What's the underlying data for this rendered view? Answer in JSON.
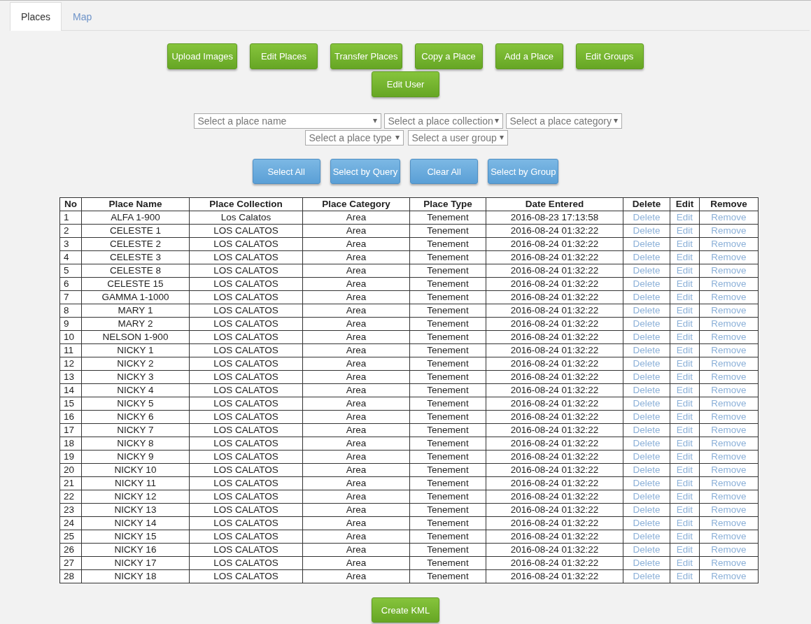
{
  "tabs": [
    {
      "label": "Places",
      "selected": true
    },
    {
      "label": "Map",
      "selected": false
    }
  ],
  "action_buttons": [
    "Upload Images",
    "Edit Places",
    "Transfer Places",
    "Copy a Place",
    "Add a Place",
    "Edit Groups",
    "Edit User"
  ],
  "filters": [
    {
      "placeholder": "Select a place name"
    },
    {
      "placeholder": "Select a place collection"
    },
    {
      "placeholder": "Select a place category"
    },
    {
      "placeholder": "Select a place type"
    },
    {
      "placeholder": "Select a user group"
    }
  ],
  "selection_buttons": [
    "Select All",
    "Select by Query",
    "Clear All",
    "Select by Group"
  ],
  "table": {
    "columns": [
      "No",
      "Place Name",
      "Place Collection",
      "Place Category",
      "Place Type",
      "Date Entered",
      "Delete",
      "Edit",
      "Remove"
    ],
    "rows": [
      {
        "no": "1",
        "name": "ALFA 1-900",
        "collection": "Los Calatos",
        "category": "Area",
        "type": "Tenement",
        "date": "2016-08-23 17:13:58",
        "delete": "Delete",
        "edit": "Edit",
        "remove": "Remove"
      },
      {
        "no": "2",
        "name": "CELESTE 1",
        "collection": "LOS CALATOS",
        "category": "Area",
        "type": "Tenement",
        "date": "2016-08-24 01:32:22",
        "delete": "Delete",
        "edit": "Edit",
        "remove": "Remove"
      },
      {
        "no": "3",
        "name": "CELESTE 2",
        "collection": "LOS CALATOS",
        "category": "Area",
        "type": "Tenement",
        "date": "2016-08-24 01:32:22",
        "delete": "Delete",
        "edit": "Edit",
        "remove": "Remove"
      },
      {
        "no": "4",
        "name": "CELESTE 3",
        "collection": "LOS CALATOS",
        "category": "Area",
        "type": "Tenement",
        "date": "2016-08-24 01:32:22",
        "delete": "Delete",
        "edit": "Edit",
        "remove": "Remove"
      },
      {
        "no": "5",
        "name": "CELESTE 8",
        "collection": "LOS CALATOS",
        "category": "Area",
        "type": "Tenement",
        "date": "2016-08-24 01:32:22",
        "delete": "Delete",
        "edit": "Edit",
        "remove": "Remove"
      },
      {
        "no": "6",
        "name": "CELESTE 15",
        "collection": "LOS CALATOS",
        "category": "Area",
        "type": "Tenement",
        "date": "2016-08-24 01:32:22",
        "delete": "Delete",
        "edit": "Edit",
        "remove": "Remove"
      },
      {
        "no": "7",
        "name": "GAMMA 1-1000",
        "collection": "LOS CALATOS",
        "category": "Area",
        "type": "Tenement",
        "date": "2016-08-24 01:32:22",
        "delete": "Delete",
        "edit": "Edit",
        "remove": "Remove"
      },
      {
        "no": "8",
        "name": "MARY 1",
        "collection": "LOS CALATOS",
        "category": "Area",
        "type": "Tenement",
        "date": "2016-08-24 01:32:22",
        "delete": "Delete",
        "edit": "Edit",
        "remove": "Remove"
      },
      {
        "no": "9",
        "name": "MARY 2",
        "collection": "LOS CALATOS",
        "category": "Area",
        "type": "Tenement",
        "date": "2016-08-24 01:32:22",
        "delete": "Delete",
        "edit": "Edit",
        "remove": "Remove"
      },
      {
        "no": "10",
        "name": "NELSON 1-900",
        "collection": "LOS CALATOS",
        "category": "Area",
        "type": "Tenement",
        "date": "2016-08-24 01:32:22",
        "delete": "Delete",
        "edit": "Edit",
        "remove": "Remove"
      },
      {
        "no": "11",
        "name": "NICKY 1",
        "collection": "LOS CALATOS",
        "category": "Area",
        "type": "Tenement",
        "date": "2016-08-24 01:32:22",
        "delete": "Delete",
        "edit": "Edit",
        "remove": "Remove"
      },
      {
        "no": "12",
        "name": "NICKY 2",
        "collection": "LOS CALATOS",
        "category": "Area",
        "type": "Tenement",
        "date": "2016-08-24 01:32:22",
        "delete": "Delete",
        "edit": "Edit",
        "remove": "Remove"
      },
      {
        "no": "13",
        "name": "NICKY 3",
        "collection": "LOS CALATOS",
        "category": "Area",
        "type": "Tenement",
        "date": "2016-08-24 01:32:22",
        "delete": "Delete",
        "edit": "Edit",
        "remove": "Remove"
      },
      {
        "no": "14",
        "name": "NICKY 4",
        "collection": "LOS CALATOS",
        "category": "Area",
        "type": "Tenement",
        "date": "2016-08-24 01:32:22",
        "delete": "Delete",
        "edit": "Edit",
        "remove": "Remove"
      },
      {
        "no": "15",
        "name": "NICKY 5",
        "collection": "LOS CALATOS",
        "category": "Area",
        "type": "Tenement",
        "date": "2016-08-24 01:32:22",
        "delete": "Delete",
        "edit": "Edit",
        "remove": "Remove"
      },
      {
        "no": "16",
        "name": "NICKY 6",
        "collection": "LOS CALATOS",
        "category": "Area",
        "type": "Tenement",
        "date": "2016-08-24 01:32:22",
        "delete": "Delete",
        "edit": "Edit",
        "remove": "Remove"
      },
      {
        "no": "17",
        "name": "NICKY 7",
        "collection": "LOS CALATOS",
        "category": "Area",
        "type": "Tenement",
        "date": "2016-08-24 01:32:22",
        "delete": "Delete",
        "edit": "Edit",
        "remove": "Remove"
      },
      {
        "no": "18",
        "name": "NICKY 8",
        "collection": "LOS CALATOS",
        "category": "Area",
        "type": "Tenement",
        "date": "2016-08-24 01:32:22",
        "delete": "Delete",
        "edit": "Edit",
        "remove": "Remove"
      },
      {
        "no": "19",
        "name": "NICKY 9",
        "collection": "LOS CALATOS",
        "category": "Area",
        "type": "Tenement",
        "date": "2016-08-24 01:32:22",
        "delete": "Delete",
        "edit": "Edit",
        "remove": "Remove"
      },
      {
        "no": "20",
        "name": "NICKY 10",
        "collection": "LOS CALATOS",
        "category": "Area",
        "type": "Tenement",
        "date": "2016-08-24 01:32:22",
        "delete": "Delete",
        "edit": "Edit",
        "remove": "Remove"
      },
      {
        "no": "21",
        "name": "NICKY 11",
        "collection": "LOS CALATOS",
        "category": "Area",
        "type": "Tenement",
        "date": "2016-08-24 01:32:22",
        "delete": "Delete",
        "edit": "Edit",
        "remove": "Remove"
      },
      {
        "no": "22",
        "name": "NICKY 12",
        "collection": "LOS CALATOS",
        "category": "Area",
        "type": "Tenement",
        "date": "2016-08-24 01:32:22",
        "delete": "Delete",
        "edit": "Edit",
        "remove": "Remove"
      },
      {
        "no": "23",
        "name": "NICKY 13",
        "collection": "LOS CALATOS",
        "category": "Area",
        "type": "Tenement",
        "date": "2016-08-24 01:32:22",
        "delete": "Delete",
        "edit": "Edit",
        "remove": "Remove"
      },
      {
        "no": "24",
        "name": "NICKY 14",
        "collection": "LOS CALATOS",
        "category": "Area",
        "type": "Tenement",
        "date": "2016-08-24 01:32:22",
        "delete": "Delete",
        "edit": "Edit",
        "remove": "Remove"
      },
      {
        "no": "25",
        "name": "NICKY 15",
        "collection": "LOS CALATOS",
        "category": "Area",
        "type": "Tenement",
        "date": "2016-08-24 01:32:22",
        "delete": "Delete",
        "edit": "Edit",
        "remove": "Remove"
      },
      {
        "no": "26",
        "name": "NICKY 16",
        "collection": "LOS CALATOS",
        "category": "Area",
        "type": "Tenement",
        "date": "2016-08-24 01:32:22",
        "delete": "Delete",
        "edit": "Edit",
        "remove": "Remove"
      },
      {
        "no": "27",
        "name": "NICKY 17",
        "collection": "LOS CALATOS",
        "category": "Area",
        "type": "Tenement",
        "date": "2016-08-24 01:32:22",
        "delete": "Delete",
        "edit": "Edit",
        "remove": "Remove"
      },
      {
        "no": "28",
        "name": "NICKY 18",
        "collection": "LOS CALATOS",
        "category": "Area",
        "type": "Tenement",
        "date": "2016-08-24 01:32:22",
        "delete": "Delete",
        "edit": "Edit",
        "remove": "Remove"
      }
    ]
  },
  "footer_button": "Create KML"
}
